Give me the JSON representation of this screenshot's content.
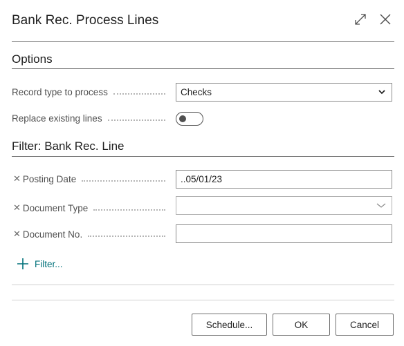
{
  "dialog": {
    "title": "Bank Rec. Process Lines",
    "expand_icon": "expand-icon",
    "close_icon": "close-icon"
  },
  "options": {
    "heading": "Options",
    "record_type_label": "Record type to process",
    "record_type_value": "Checks",
    "replace_label": "Replace existing lines",
    "replace_value": false
  },
  "filter": {
    "heading": "Filter: Bank Rec. Line",
    "fields": [
      {
        "label": "Posting Date",
        "value": "..05/01/23"
      },
      {
        "label": "Document Type",
        "value": ""
      },
      {
        "label": "Document No.",
        "value": ""
      }
    ],
    "add_filter_label": "Filter..."
  },
  "buttons": {
    "schedule": "Schedule...",
    "ok": "OK",
    "cancel": "Cancel"
  },
  "colors": {
    "accent": "#00717a",
    "text": "#212121",
    "label": "#505050"
  }
}
